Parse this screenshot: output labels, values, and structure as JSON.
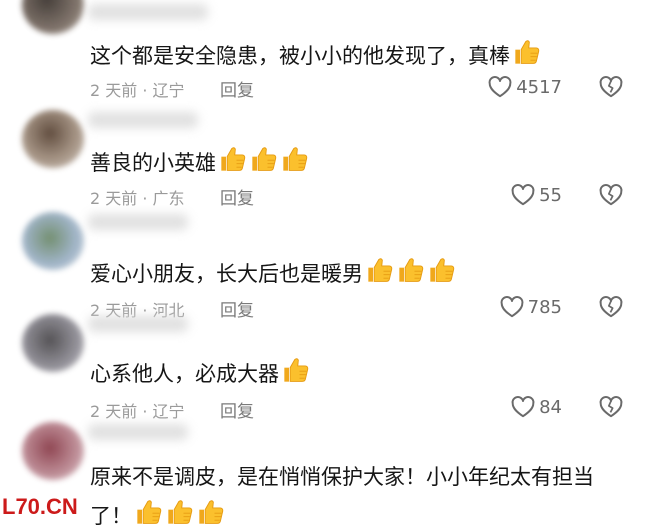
{
  "comments": [
    {
      "text": "这个都是安全隐患，被小小的他发现了，真棒",
      "thumbs": 1,
      "time": "2 天前 · 辽宁",
      "reply": "回复",
      "likes": "4517"
    },
    {
      "text": "善良的小英雄",
      "thumbs": 3,
      "time": "2 天前 · 广东",
      "reply": "回复",
      "likes": "55"
    },
    {
      "text": "爱心小朋友，长大后也是暖男",
      "thumbs": 3,
      "time": "2 天前 · 河北",
      "reply": "回复",
      "likes": "785"
    },
    {
      "text": "心系他人，必成大器",
      "thumbs": 1,
      "time": "2 天前 · 辽宁",
      "reply": "回复",
      "likes": "84"
    },
    {
      "text": "原来不是调皮，是在悄悄保护大家！小小年纪太有担当",
      "text2": "了！",
      "thumbs": 3
    }
  ],
  "watermark": "L70.CN",
  "icons": {
    "like": "heart-outline-icon",
    "dislike": "broken-heart-icon",
    "emoji": "thumbs-up-emoji"
  },
  "colors": {
    "text": "#161616",
    "meta": "#9a9a9a",
    "icon": "#6a6a6a",
    "emoji": "#f7b928",
    "watermark": "#cc1a1a"
  }
}
